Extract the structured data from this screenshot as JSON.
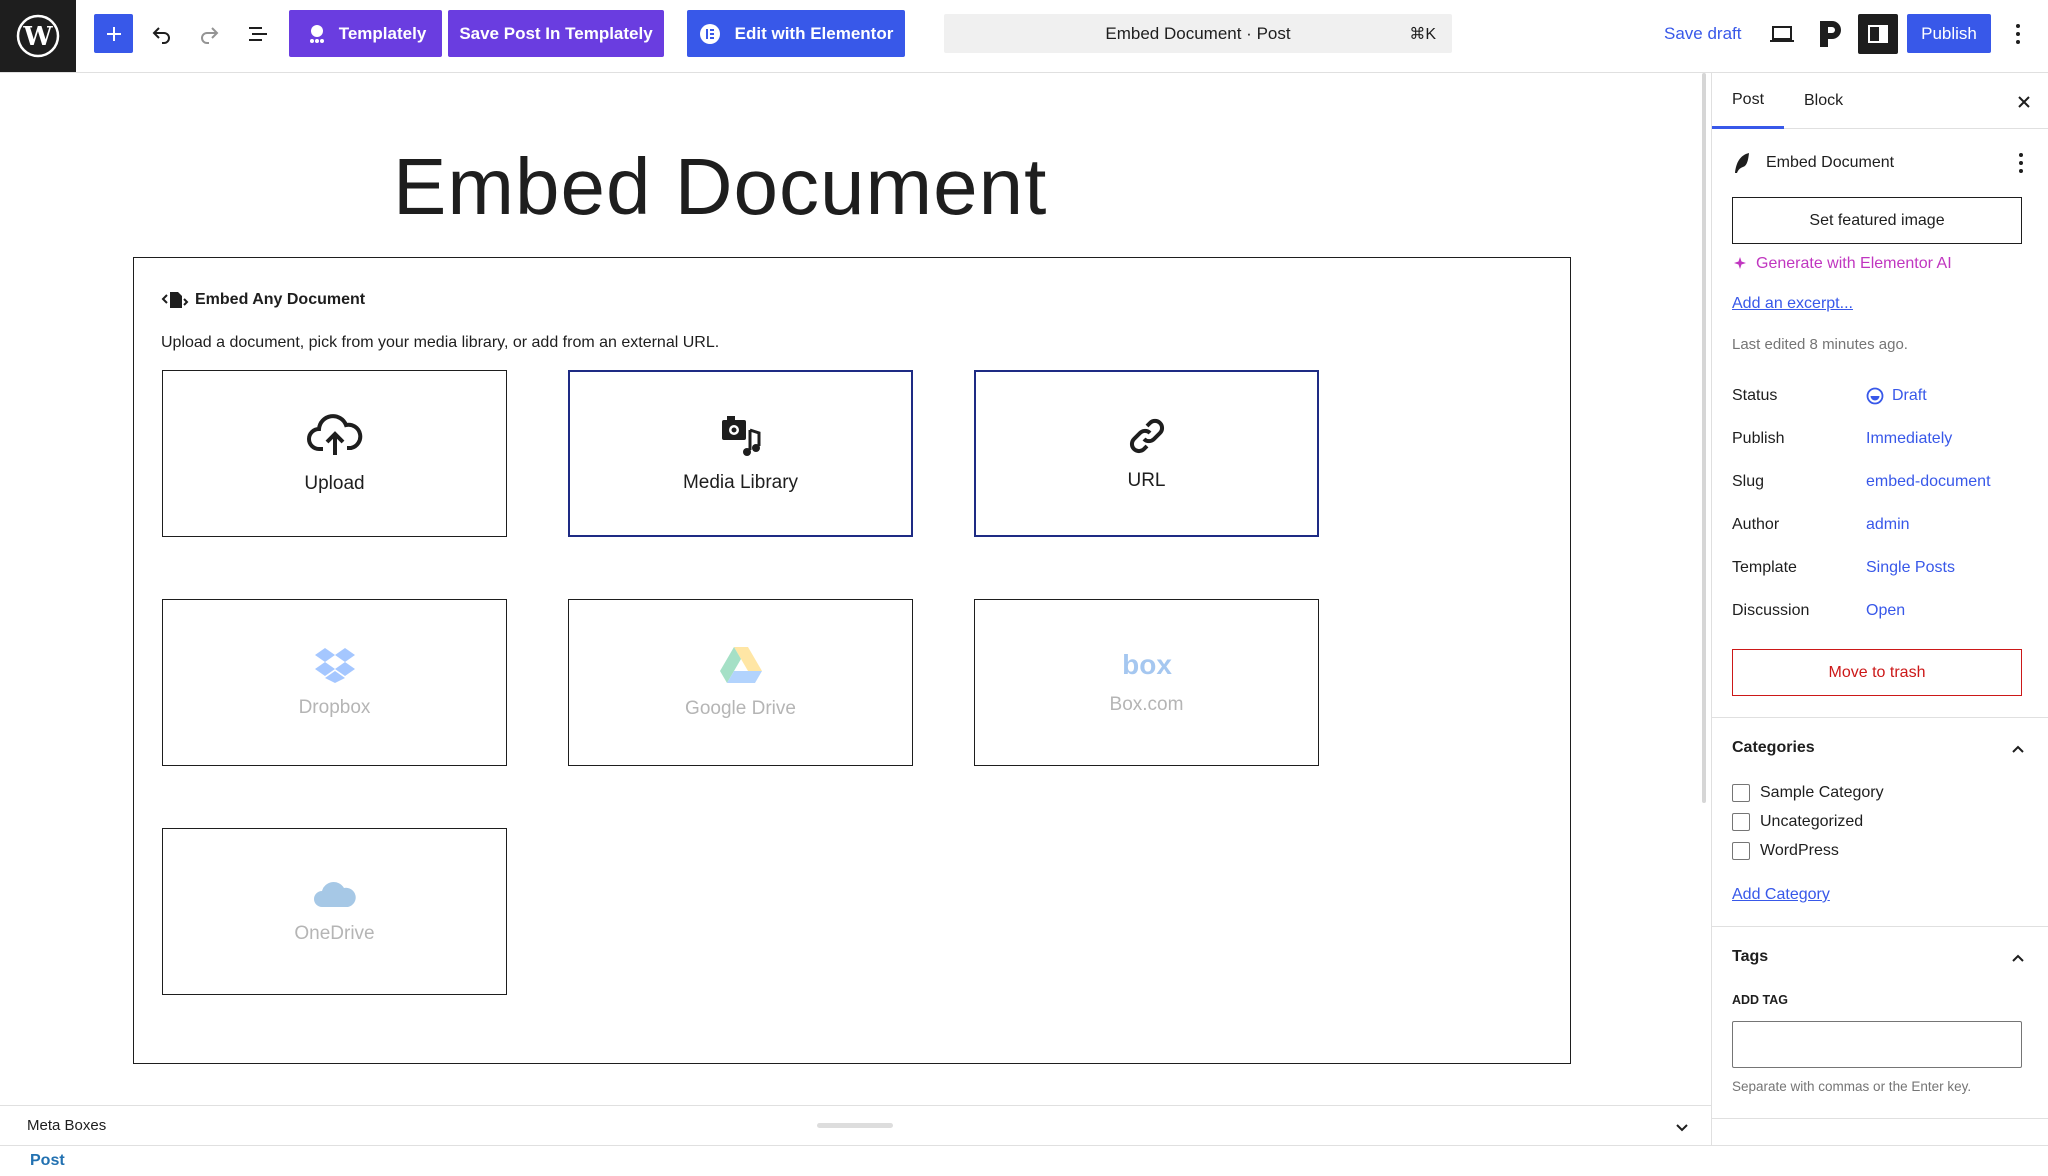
{
  "topbar": {
    "templately_label": "Templately",
    "save_templately_label": "Save Post In Templately",
    "elementor_label": "Edit with Elementor",
    "command_title": "Embed Document · Post",
    "command_shortcut": "⌘K",
    "save_draft_label": "Save draft",
    "publish_label": "Publish"
  },
  "editor": {
    "post_title": "Embed Document",
    "embed_block": {
      "title": "Embed Any Document",
      "description": "Upload a document, pick from your media library, or add from an external URL.",
      "tiles": [
        {
          "label": "Upload",
          "icon": "cloud-upload-icon",
          "state": "normal"
        },
        {
          "label": "Media Library",
          "icon": "media-library-icon",
          "state": "active"
        },
        {
          "label": "URL",
          "icon": "link-icon",
          "state": "active"
        },
        {
          "label": "Dropbox",
          "icon": "dropbox-icon",
          "state": "disabled"
        },
        {
          "label": "Google Drive",
          "icon": "google-drive-icon",
          "state": "disabled"
        },
        {
          "label": "Box.com",
          "icon": "box-icon",
          "state": "disabled"
        },
        {
          "label": "OneDrive",
          "icon": "onedrive-icon",
          "state": "disabled"
        }
      ]
    }
  },
  "metabox": {
    "label": "Meta Boxes"
  },
  "footer": {
    "breadcrumb": "Post"
  },
  "sidebar": {
    "tabs": [
      "Post",
      "Block"
    ],
    "post_name": "Embed Document",
    "featured_image_label": "Set featured image",
    "ai_label": "Generate with Elementor AI",
    "excerpt_label": "Add an excerpt...",
    "last_edited": "Last edited 8 minutes ago.",
    "fields": [
      {
        "label": "Status",
        "value": "Draft"
      },
      {
        "label": "Publish",
        "value": "Immediately"
      },
      {
        "label": "Slug",
        "value": "embed-document"
      },
      {
        "label": "Author",
        "value": "admin"
      },
      {
        "label": "Template",
        "value": "Single Posts"
      },
      {
        "label": "Discussion",
        "value": "Open"
      }
    ],
    "trash_label": "Move to trash",
    "categories": {
      "title": "Categories",
      "items": [
        "Sample Category",
        "Uncategorized",
        "WordPress"
      ],
      "add_label": "Add Category"
    },
    "tags": {
      "title": "Tags",
      "input_label": "ADD TAG",
      "hint": "Separate with commas or the Enter key."
    }
  },
  "colors": {
    "accent": "#3858e9",
    "templately": "#6a3de0",
    "danger": "#cc1818",
    "ai": "#c036c0"
  }
}
